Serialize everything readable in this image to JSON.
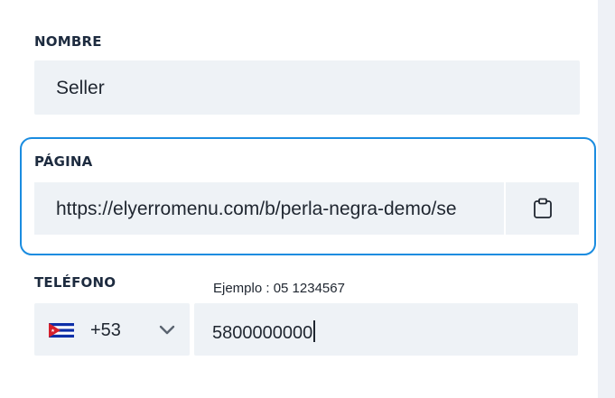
{
  "form": {
    "nombre": {
      "label": "NOMBRE",
      "value": "Seller"
    },
    "pagina": {
      "label": "PÁGINA",
      "value": "https://elyerromenu.com/b/perla-negra-demo/se",
      "copy_icon": "clipboard-icon"
    },
    "telefono": {
      "label": "TELÉFONO",
      "hint": "Ejemplo : 05 1234567",
      "country_flag": "cuba-flag-icon",
      "country_code": "+53",
      "dropdown_icon": "chevron-down-icon",
      "number": "5800000000"
    }
  },
  "colors": {
    "focus_border": "#1a8ce0",
    "field_background": "#eef2f6",
    "label_text": "#1d2b3f",
    "page_background": "#eef1f6"
  }
}
